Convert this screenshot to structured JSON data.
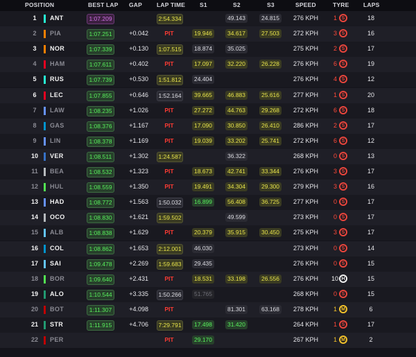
{
  "header": {
    "position": "POSITION",
    "best_lap": "BEST LAP",
    "gap": "GAP",
    "lap_time": "LAP TIME",
    "s1": "S1",
    "s2": "S2",
    "s3": "S3",
    "speed": "SPEED",
    "tyre": "TYRE",
    "laps": "LAPS"
  },
  "colors": {
    "sector_yellow": "#e6e24a",
    "sector_green": "#58ef5c",
    "sector_purple": "#d070e6",
    "pit_red": "#ff3b33",
    "soft_tyre": "#e8453c",
    "medium_tyre": "#f3c22b",
    "hard_tyre": "#f2f2f2"
  },
  "rows": [
    {
      "pos": "1",
      "code": "ANT",
      "team_color": "#27f4d2",
      "best": "1:07.209",
      "best_purple": true,
      "gap": "",
      "lap_time": "2:54.334",
      "lap_style": "y",
      "s1": "",
      "s1_style": "",
      "s2": "49.143",
      "s2_style": "w",
      "s3": "24.815",
      "s3_style": "w",
      "speed": "276 KPH",
      "tyre_age": "1",
      "tyre": "S",
      "tyre_style": "s",
      "laps": "18",
      "dim": false
    },
    {
      "pos": "2",
      "code": "PIA",
      "team_color": "#ff8000",
      "best": "1:07.251",
      "best_purple": false,
      "gap": "+0.042",
      "lap_time": "PIT",
      "lap_style": "pit",
      "s1": "19.946",
      "s1_style": "y",
      "s2": "34.617",
      "s2_style": "y",
      "s3": "27.503",
      "s3_style": "y",
      "speed": "272 KPH",
      "tyre_age": "3",
      "tyre": "S",
      "tyre_style": "s",
      "laps": "16",
      "dim": true
    },
    {
      "pos": "3",
      "code": "NOR",
      "team_color": "#ff8000",
      "best": "1:07.339",
      "best_purple": false,
      "gap": "+0.130",
      "lap_time": "1:07.515",
      "lap_style": "y",
      "s1": "18.874",
      "s1_style": "w",
      "s2": "35.025",
      "s2_style": "w",
      "s3": "",
      "s3_style": "",
      "speed": "275 KPH",
      "tyre_age": "2",
      "tyre": "S",
      "tyre_style": "s",
      "laps": "17",
      "dim": false
    },
    {
      "pos": "4",
      "code": "HAM",
      "team_color": "#e80020",
      "best": "1:07.611",
      "best_purple": false,
      "gap": "+0.402",
      "lap_time": "PIT",
      "lap_style": "pit",
      "s1": "17.097",
      "s1_style": "y",
      "s2": "32.220",
      "s2_style": "y",
      "s3": "26.228",
      "s3_style": "y",
      "speed": "276 KPH",
      "tyre_age": "6",
      "tyre": "S",
      "tyre_style": "s",
      "laps": "19",
      "dim": true
    },
    {
      "pos": "5",
      "code": "RUS",
      "team_color": "#27f4d2",
      "best": "1:07.739",
      "best_purple": false,
      "gap": "+0.530",
      "lap_time": "1:51.812",
      "lap_style": "y",
      "s1": "24.404",
      "s1_style": "w",
      "s2": "",
      "s2_style": "",
      "s3": "",
      "s3_style": "",
      "speed": "276 KPH",
      "tyre_age": "4",
      "tyre": "S",
      "tyre_style": "s",
      "laps": "12",
      "dim": false
    },
    {
      "pos": "6",
      "code": "LEC",
      "team_color": "#e80020",
      "best": "1:07.855",
      "best_purple": false,
      "gap": "+0.646",
      "lap_time": "1:52.164",
      "lap_style": "w",
      "s1": "39.665",
      "s1_style": "y",
      "s2": "46.883",
      "s2_style": "y",
      "s3": "25.616",
      "s3_style": "y",
      "speed": "277 KPH",
      "tyre_age": "1",
      "tyre": "S",
      "tyre_style": "s",
      "laps": "20",
      "dim": false
    },
    {
      "pos": "7",
      "code": "LAW",
      "team_color": "#6692ff",
      "best": "1:08.235",
      "best_purple": false,
      "gap": "+1.026",
      "lap_time": "PIT",
      "lap_style": "pit",
      "s1": "27.272",
      "s1_style": "y",
      "s2": "44.763",
      "s2_style": "y",
      "s3": "29.268",
      "s3_style": "y",
      "speed": "272 KPH",
      "tyre_age": "6",
      "tyre": "S",
      "tyre_style": "s",
      "laps": "18",
      "dim": true
    },
    {
      "pos": "8",
      "code": "GAS",
      "team_color": "#0093cc",
      "best": "1:08.376",
      "best_purple": false,
      "gap": "+1.167",
      "lap_time": "PIT",
      "lap_style": "pit",
      "s1": "17.090",
      "s1_style": "y",
      "s2": "30.850",
      "s2_style": "y",
      "s3": "26.410",
      "s3_style": "y",
      "speed": "286 KPH",
      "tyre_age": "2",
      "tyre": "S",
      "tyre_style": "s",
      "laps": "17",
      "dim": true
    },
    {
      "pos": "9",
      "code": "LIN",
      "team_color": "#6692ff",
      "best": "1:08.378",
      "best_purple": false,
      "gap": "+1.169",
      "lap_time": "PIT",
      "lap_style": "pit",
      "s1": "19.039",
      "s1_style": "y",
      "s2": "33.202",
      "s2_style": "y",
      "s3": "25.741",
      "s3_style": "y",
      "speed": "272 KPH",
      "tyre_age": "6",
      "tyre": "S",
      "tyre_style": "s",
      "laps": "12",
      "dim": true
    },
    {
      "pos": "10",
      "code": "VER",
      "team_color": "#3671c6",
      "best": "1:08.511",
      "best_purple": false,
      "gap": "+1.302",
      "lap_time": "1:24.587",
      "lap_style": "y",
      "s1": "",
      "s1_style": "",
      "s2": "36.322",
      "s2_style": "w",
      "s3": "",
      "s3_style": "",
      "speed": "268 KPH",
      "tyre_age": "0",
      "tyre": "S",
      "tyre_style": "s",
      "laps": "13",
      "dim": false
    },
    {
      "pos": "11",
      "code": "BEA",
      "team_color": "#b6babd",
      "best": "1:08.532",
      "best_purple": false,
      "gap": "+1.323",
      "lap_time": "PIT",
      "lap_style": "pit",
      "s1": "18.673",
      "s1_style": "y",
      "s2": "42.741",
      "s2_style": "y",
      "s3": "33.344",
      "s3_style": "y",
      "speed": "276 KPH",
      "tyre_age": "3",
      "tyre": "S",
      "tyre_style": "s",
      "laps": "17",
      "dim": true
    },
    {
      "pos": "12",
      "code": "HUL",
      "team_color": "#52e252",
      "best": "1:08.559",
      "best_purple": false,
      "gap": "+1.350",
      "lap_time": "PIT",
      "lap_style": "pit",
      "s1": "19.491",
      "s1_style": "y",
      "s2": "34.304",
      "s2_style": "y",
      "s3": "29.300",
      "s3_style": "y",
      "speed": "279 KPH",
      "tyre_age": "3",
      "tyre": "S",
      "tyre_style": "s",
      "laps": "16",
      "dim": true
    },
    {
      "pos": "13",
      "code": "HAD",
      "team_color": "#6692ff",
      "best": "1:08.772",
      "best_purple": false,
      "gap": "+1.563",
      "lap_time": "1:50.032",
      "lap_style": "w",
      "s1": "16.899",
      "s1_style": "g",
      "s2": "56.408",
      "s2_style": "y",
      "s3": "36.725",
      "s3_style": "y",
      "speed": "277 KPH",
      "tyre_age": "0",
      "tyre": "S",
      "tyre_style": "s",
      "laps": "17",
      "dim": false
    },
    {
      "pos": "14",
      "code": "OCO",
      "team_color": "#b6babd",
      "best": "1:08.830",
      "best_purple": false,
      "gap": "+1.621",
      "lap_time": "1:59.502",
      "lap_style": "y",
      "s1": "",
      "s1_style": "",
      "s2": "49.599",
      "s2_style": "w",
      "s3": "",
      "s3_style": "",
      "speed": "273 KPH",
      "tyre_age": "0",
      "tyre": "S",
      "tyre_style": "s",
      "laps": "17",
      "dim": false
    },
    {
      "pos": "15",
      "code": "ALB",
      "team_color": "#64c4ff",
      "best": "1:08.838",
      "best_purple": false,
      "gap": "+1.629",
      "lap_time": "PIT",
      "lap_style": "pit",
      "s1": "20.379",
      "s1_style": "y",
      "s2": "35.915",
      "s2_style": "y",
      "s3": "30.450",
      "s3_style": "y",
      "speed": "275 KPH",
      "tyre_age": "3",
      "tyre": "S",
      "tyre_style": "s",
      "laps": "17",
      "dim": true
    },
    {
      "pos": "16",
      "code": "COL",
      "team_color": "#0093cc",
      "best": "1:08.862",
      "best_purple": false,
      "gap": "+1.653",
      "lap_time": "2:12.001",
      "lap_style": "y",
      "s1": "46.030",
      "s1_style": "w",
      "s2": "",
      "s2_style": "",
      "s3": "",
      "s3_style": "",
      "speed": "273 KPH",
      "tyre_age": "0",
      "tyre": "S",
      "tyre_style": "s",
      "laps": "14",
      "dim": false
    },
    {
      "pos": "17",
      "code": "SAI",
      "team_color": "#64c4ff",
      "best": "1:09.478",
      "best_purple": false,
      "gap": "+2.269",
      "lap_time": "1:59.683",
      "lap_style": "y",
      "s1": "29.435",
      "s1_style": "w",
      "s2": "",
      "s2_style": "",
      "s3": "",
      "s3_style": "",
      "speed": "276 KPH",
      "tyre_age": "0",
      "tyre": "S",
      "tyre_style": "s",
      "laps": "15",
      "dim": false
    },
    {
      "pos": "18",
      "code": "BOR",
      "team_color": "#52e252",
      "best": "1:09.640",
      "best_purple": false,
      "gap": "+2.431",
      "lap_time": "PIT",
      "lap_style": "pit",
      "s1": "18.531",
      "s1_style": "y",
      "s2": "33.198",
      "s2_style": "y",
      "s3": "26.556",
      "s3_style": "y",
      "speed": "276 KPH",
      "tyre_age": "10",
      "tyre": "H",
      "tyre_style": "h",
      "laps": "15",
      "dim": true
    },
    {
      "pos": "19",
      "code": "ALO",
      "team_color": "#229971",
      "best": "1:10.544",
      "best_purple": false,
      "gap": "+3.335",
      "lap_time": "1:50.266",
      "lap_style": "w",
      "s1": "51.765",
      "s1_style": "dgr",
      "s2": "",
      "s2_style": "",
      "s3": "",
      "s3_style": "",
      "speed": "268 KPH",
      "tyre_age": "0",
      "tyre": "S",
      "tyre_style": "s",
      "laps": "15",
      "dim": false
    },
    {
      "pos": "20",
      "code": "BOT",
      "team_color": "#c00000",
      "best": "1:11.307",
      "best_purple": false,
      "gap": "+4.098",
      "lap_time": "PIT",
      "lap_style": "pit",
      "s1": "",
      "s1_style": "",
      "s2": "81.301",
      "s2_style": "w",
      "s3": "63.168",
      "s3_style": "w",
      "speed": "278 KPH",
      "tyre_age": "1",
      "tyre": "M",
      "tyre_style": "m",
      "laps": "6",
      "dim": true
    },
    {
      "pos": "21",
      "code": "STR",
      "team_color": "#229971",
      "best": "1:11.915",
      "best_purple": false,
      "gap": "+4.706",
      "lap_time": "7:29.791",
      "lap_style": "y",
      "s1": "17.498",
      "s1_style": "g",
      "s2": "31.420",
      "s2_style": "g",
      "s3": "",
      "s3_style": "",
      "speed": "264 KPH",
      "tyre_age": "1",
      "tyre": "S",
      "tyre_style": "s",
      "laps": "17",
      "dim": false
    },
    {
      "pos": "22",
      "code": "PER",
      "team_color": "#c00000",
      "best": "",
      "best_purple": false,
      "gap": "",
      "lap_time": "PIT",
      "lap_style": "pit",
      "s1": "29.170",
      "s1_style": "g",
      "s2": "",
      "s2_style": "",
      "s3": "",
      "s3_style": "",
      "speed": "267 KPH",
      "tyre_age": "1",
      "tyre": "M",
      "tyre_style": "m",
      "laps": "2",
      "dim": true
    }
  ]
}
